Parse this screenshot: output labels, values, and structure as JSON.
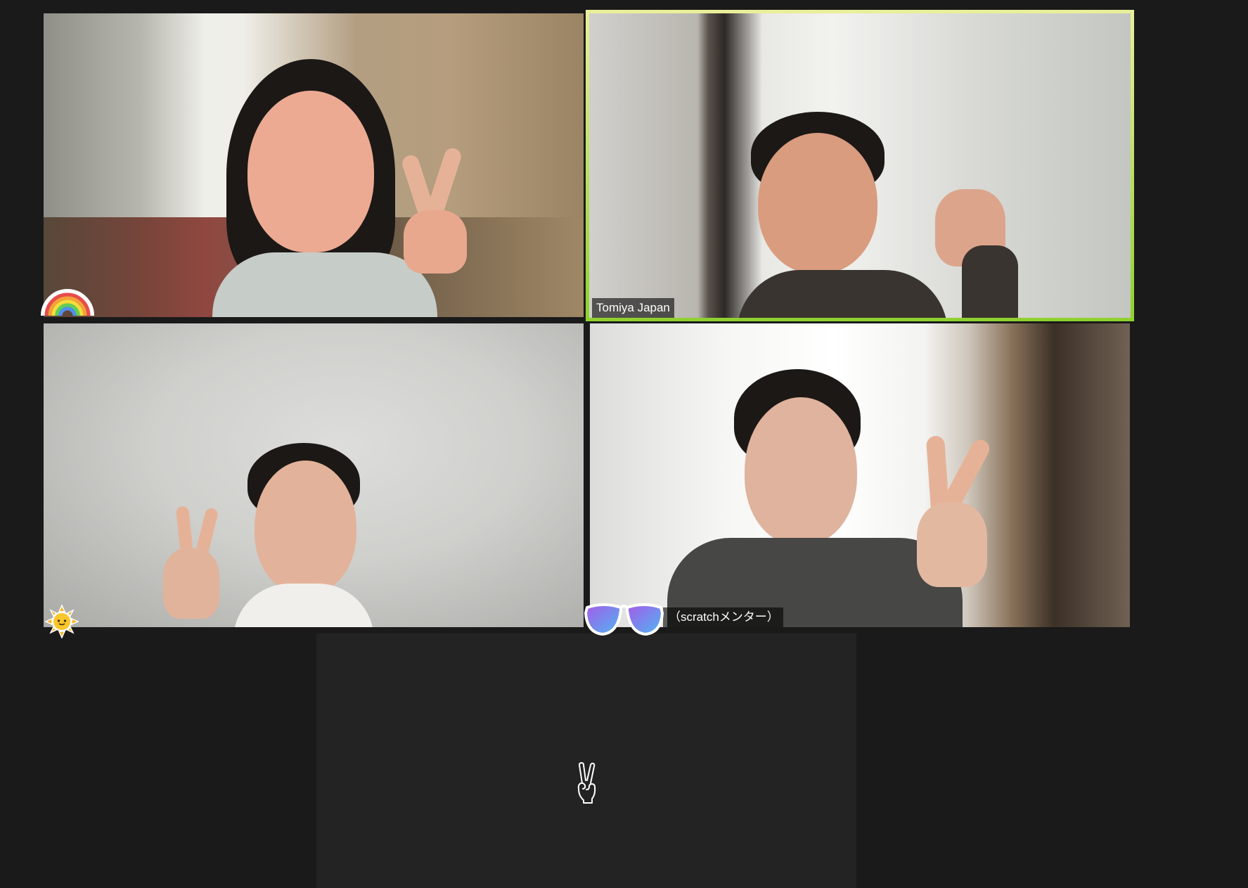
{
  "app": {
    "view": "gallery"
  },
  "participants": [
    {
      "name": "",
      "reaction_icon": "rainbow-icon",
      "video_on": true
    },
    {
      "name": "Tomiya Japan",
      "active_speaker": true,
      "video_on": true
    },
    {
      "name": "",
      "reaction_icon": "sun-icon",
      "video_on": true
    },
    {
      "name": "（scratchメンター）",
      "reaction_icon": "sunglasses-icon",
      "video_on": true
    },
    {
      "name": "",
      "reaction_icon": "peace-hand-icon",
      "video_on": false
    }
  ],
  "colors": {
    "background": "#1a1a1a",
    "tile_off": "#232323",
    "active_speaker_border": "#c7e35f",
    "label_text": "#ffffff"
  }
}
